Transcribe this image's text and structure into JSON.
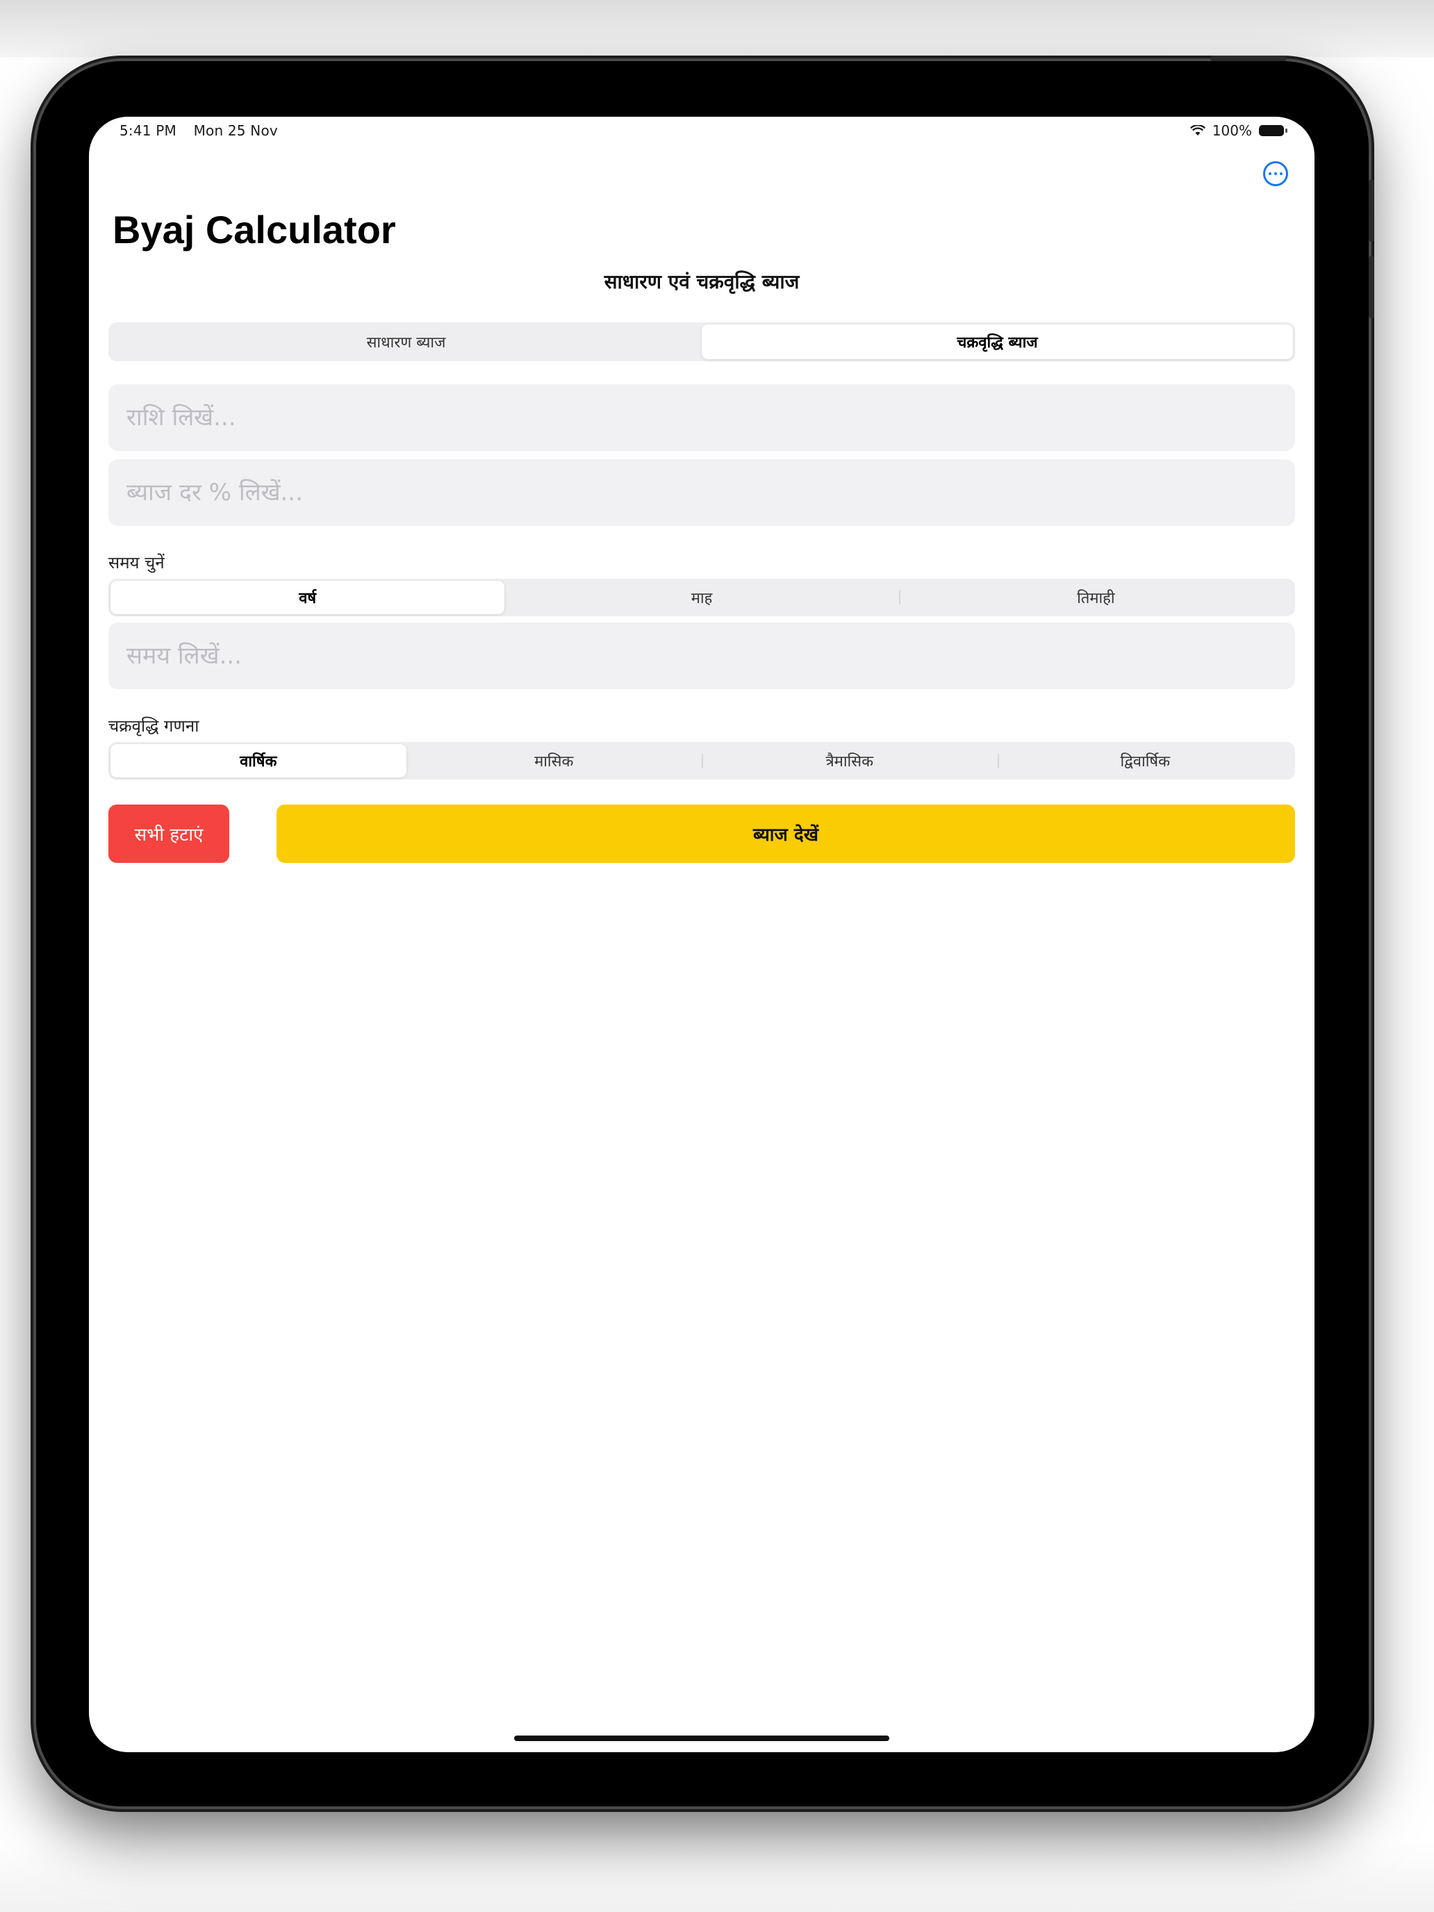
{
  "status_bar": {
    "time": "5:41 PM",
    "date": "Mon 25 Nov",
    "battery": "100%"
  },
  "nav": {
    "title": "Byaj Calculator",
    "more_icon": "ellipsis-circle-icon"
  },
  "subtitle": "साधारण एवं चक्रवृद्धि ब्याज",
  "interest_type": {
    "options": [
      "साधारण ब्याज",
      "चक्रवृद्धि ब्याज"
    ],
    "selected": "चक्रवृद्धि ब्याज"
  },
  "fields": {
    "amount_placeholder": "राशि लिखें...",
    "rate_placeholder": "ब्याज दर % लिखें...",
    "time_placeholder": "समय लिखें..."
  },
  "time_unit": {
    "label": "समय चुनें",
    "options": [
      "वर्ष",
      "माह",
      "तिमाही"
    ],
    "selected": "वर्ष"
  },
  "compounding": {
    "label": "चक्रवृद्धि गणना",
    "options": [
      "वार्षिक",
      "मासिक",
      "त्रैमासिक",
      "द्विवार्षिक"
    ],
    "selected": "वार्षिक"
  },
  "buttons": {
    "clear_all": "सभी हटाएं",
    "show_interest": "ब्याज देखें"
  },
  "colors": {
    "accent": "#1677f2",
    "clear_button": "#f5433f",
    "calc_button": "#facc04"
  }
}
